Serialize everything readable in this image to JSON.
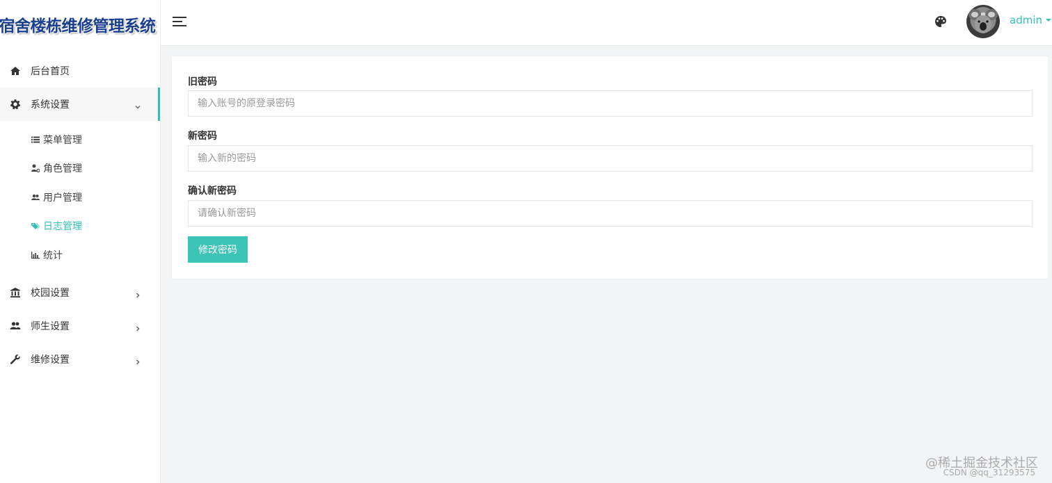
{
  "app": {
    "title": "宿舍楼栋维修管理系统"
  },
  "sidebar": {
    "items": [
      {
        "label": "后台首页",
        "icon": "home-icon"
      },
      {
        "label": "系统设置",
        "icon": "gear-icon",
        "expanded": true,
        "children": [
          {
            "label": "菜单管理",
            "icon": "list-icon"
          },
          {
            "label": "角色管理",
            "icon": "user-cog-icon"
          },
          {
            "label": "用户管理",
            "icon": "users-icon"
          },
          {
            "label": "日志管理",
            "icon": "tag-icon",
            "current": true
          },
          {
            "label": "统计",
            "icon": "bar-chart-icon"
          }
        ]
      },
      {
        "label": "校园设置",
        "icon": "bank-icon"
      },
      {
        "label": "师生设置",
        "icon": "people-icon"
      },
      {
        "label": "维修设置",
        "icon": "wrench-icon"
      }
    ]
  },
  "header": {
    "username": "admin",
    "accent_color": "#33c0b3"
  },
  "form": {
    "old_password": {
      "label": "旧密码",
      "placeholder": "输入账号的原登录密码",
      "value": ""
    },
    "new_password": {
      "label": "新密码",
      "placeholder": "输入新的密码",
      "value": ""
    },
    "confirm_password": {
      "label": "确认新密码",
      "placeholder": "请确认新密码",
      "value": ""
    },
    "submit_label": "修改密码"
  },
  "watermark": {
    "line1": "@稀土掘金技术社区",
    "line2": "CSDN @qq_31293575"
  }
}
